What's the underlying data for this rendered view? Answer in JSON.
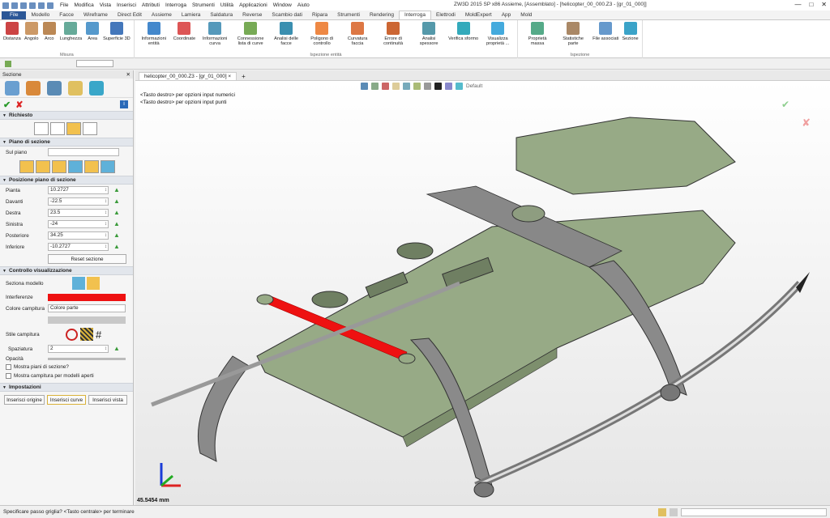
{
  "menu": [
    "File",
    "Modifica",
    "Vista",
    "Inserisci",
    "Attributi",
    "Interroga",
    "Strumenti",
    "Utilità",
    "Applicazioni",
    "Window",
    "Aiuto"
  ],
  "window_title": "ZW3D 2015 SP x86          Assieme, [Assemblato] - [helicopter_00_000.Z3 - [gr_01_000]]",
  "ribbon_tabs": [
    "File",
    "Modello",
    "Facce",
    "Wireframe",
    "Direct Edit",
    "Assieme",
    "Lamiera",
    "Saldatura",
    "Reverse",
    "Scambio dati",
    "Ripara",
    "Strumenti",
    "Rendering",
    "Interroga",
    "Elettrodi",
    "MoldExpert",
    "App",
    "Mold"
  ],
  "active_tab": "Interroga",
  "groups": [
    {
      "label": "Misura",
      "buttons": [
        "Distanza",
        "Angolo",
        "Arco",
        "Lunghezza",
        "Area",
        "Superficie 3D"
      ]
    },
    {
      "label": "Ispezione entità",
      "buttons": [
        "Informazioni entità",
        "Coordinate",
        "Informazioni curva",
        "Connessione lista di curve",
        "Analisi delle facce",
        "Poligono di controllo",
        "Curvatura faccia",
        "Errore di continuità",
        "Analisi spessore",
        "Verifica sformo",
        "Visualizza proprietà ..."
      ]
    },
    {
      "label": "Ispezione",
      "buttons": [
        "Proprietà massa",
        "Statistiche parte",
        "File associati",
        "Sezione"
      ]
    }
  ],
  "panel": {
    "title": "Sezione",
    "sec_richiesto": "Richiesto",
    "sec_piano": "Piano di sezione",
    "sul_piano": "Sul piano",
    "sec_posizione": "Posizione piano di sezione",
    "fields": [
      {
        "label": "Pianta",
        "value": "10.2727"
      },
      {
        "label": "Davanti",
        "value": "-22.5"
      },
      {
        "label": "Destra",
        "value": "23.5"
      },
      {
        "label": "Sinistra",
        "value": "-24"
      },
      {
        "label": "Posteriore",
        "value": "34.25"
      },
      {
        "label": "Inferiore",
        "value": "-10.2727"
      }
    ],
    "reset": "Reset sezione",
    "sec_controllo": "Controllo visualizzazione",
    "seziona_modello": "Seziona modello",
    "interferenze": "Interferenze",
    "colore_campitura": "Colore campitura",
    "colore_value": "Colore parte",
    "stile_campitura": "Stile campitura",
    "spaziatura": "Spaziatura",
    "spaziatura_value": "2",
    "opacita": "Opacità",
    "check1": "Mostra piani di sezione?",
    "check2": "Mostra campitura per modelli aperti",
    "sec_impostazioni": "Impostazioni",
    "btn1": "Inserisci origine",
    "btn2": "Inserisci curve",
    "btn3": "Inserisci vista"
  },
  "doc_tab": "helicopter_00_000.Z3 - [gr_01_000]",
  "view_mode": "Normal",
  "view_default": "Default",
  "prompt1": "<Tasto destro> per opzioni input numerici",
  "prompt2": "<Tasto destro> per opzioni input punti",
  "distance": "45.5454 mm",
  "status": "Specificare passo griglia? <Tasto centrale> per terminare",
  "colors": {
    "accent": "#2b5797",
    "model_green": "#97aa86",
    "interference": "#ee1111"
  }
}
